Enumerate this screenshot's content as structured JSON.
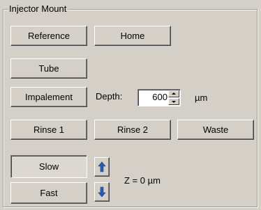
{
  "group": {
    "title": "Injector Mount"
  },
  "buttons": {
    "reference": "Reference",
    "home": "Home",
    "tube": "Tube",
    "impalement": "Impalement",
    "rinse1": "Rinse 1",
    "rinse2": "Rinse 2",
    "waste": "Waste",
    "slow": "Slow",
    "fast": "Fast"
  },
  "depth": {
    "label": "Depth:",
    "value": "600",
    "unit": "µm"
  },
  "z_readout": "Z = 0 µm",
  "icons": {
    "up": "arrow-up-icon",
    "down": "arrow-down-icon"
  },
  "colors": {
    "arrow": "#2a5db0"
  }
}
